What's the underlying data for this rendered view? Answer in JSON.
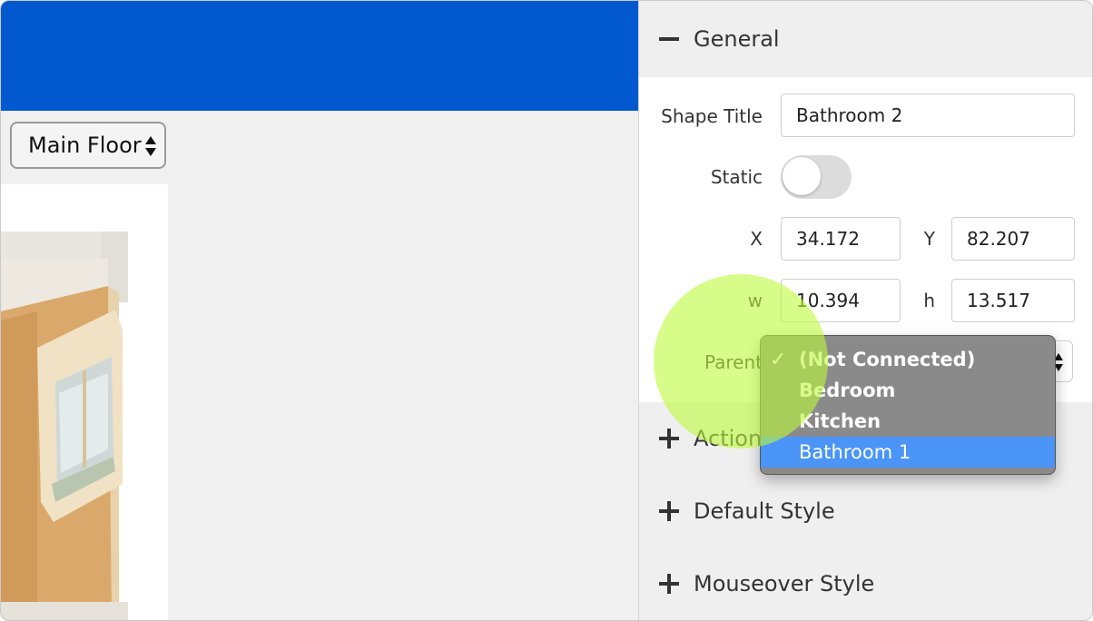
{
  "colors": {
    "banner": "#0259cf",
    "highlight": "#4a95f7",
    "halo": "#befa3c"
  },
  "floor_select": {
    "value": "Main Floor"
  },
  "panel": {
    "general": {
      "title": "General"
    },
    "shape_title": {
      "label": "Shape Title",
      "value": "Bathroom 2"
    },
    "static": {
      "label": "Static",
      "on": false
    },
    "x": {
      "label": "X",
      "value": "34.172"
    },
    "y": {
      "label": "Y",
      "value": "82.207"
    },
    "w": {
      "label": "w",
      "value": "10.394"
    },
    "h": {
      "label": "h",
      "value": "13.517"
    },
    "parent": {
      "label": "Parent",
      "options": [
        {
          "label": "(Not Connected)",
          "checked": true
        },
        {
          "label": "Bedroom"
        },
        {
          "label": "Kitchen"
        },
        {
          "label": "Bathroom 1",
          "highlighted": true
        }
      ]
    },
    "actions": {
      "title": "Actions"
    },
    "default_style": {
      "title": "Default Style"
    },
    "mouseover_style": {
      "title": "Mouseover Style"
    }
  },
  "icons": {
    "collapse": "minus-icon",
    "expand": "plus-icon",
    "selected": "checkmark-icon",
    "select_arrows": "up-down-arrows-icon"
  }
}
